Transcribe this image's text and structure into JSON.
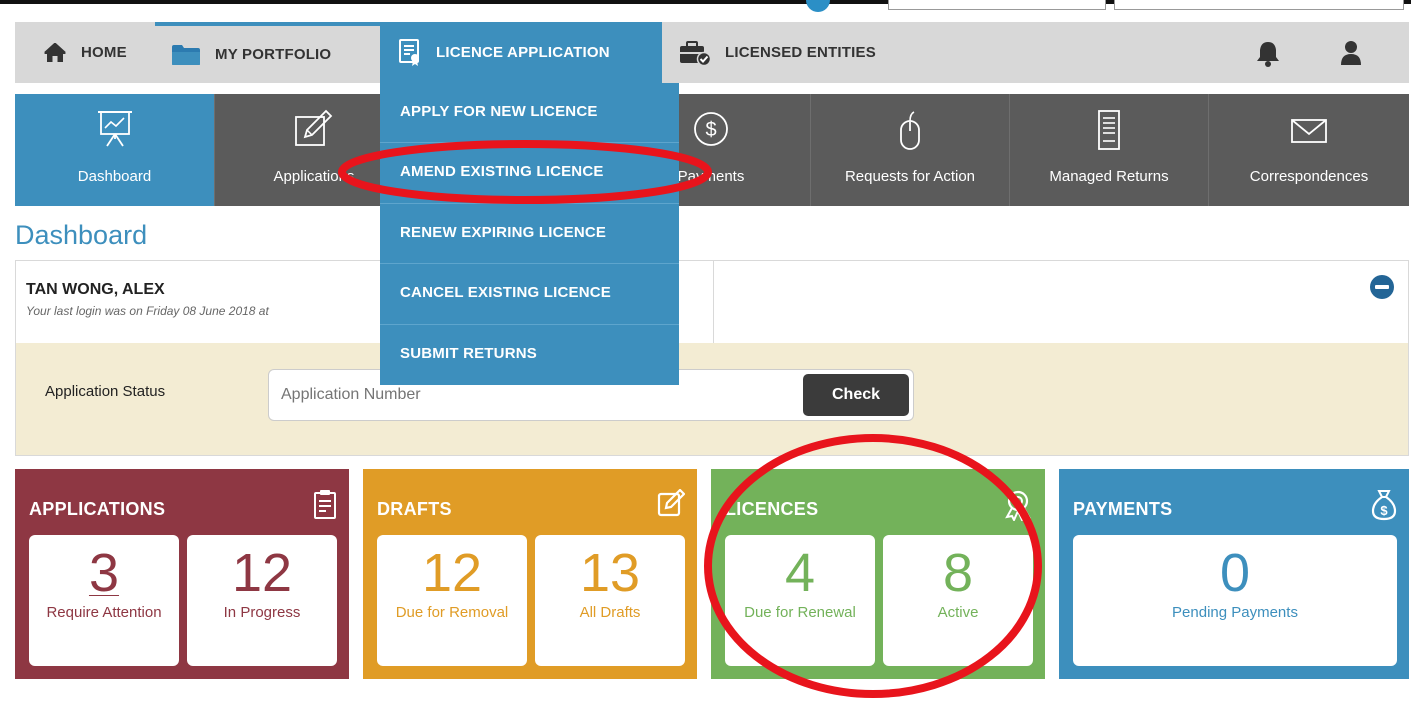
{
  "nav": {
    "home": "HOME",
    "portfolio": "MY PORTFOLIO",
    "licence_application": "LICENCE APPLICATION",
    "licensed_entities": "LICENSED ENTITIES"
  },
  "dropdown": {
    "items": [
      "APPLY FOR NEW LICENCE",
      "AMEND EXISTING LICENCE",
      "RENEW EXPIRING LICENCE",
      "CANCEL EXISTING LICENCE",
      "SUBMIT RETURNS"
    ]
  },
  "tiles": {
    "dashboard": "Dashboard",
    "applications": "Applications",
    "payments": "Payments",
    "requests": "Requests for Action",
    "returns": "Managed Returns",
    "correspondences": "Correspondences"
  },
  "dashboard": {
    "title": "Dashboard",
    "user_name": "TAN WONG, ALEX",
    "last_login": "Your last login was on Friday 08 June 2018 at",
    "status_label": "Application Status",
    "input_placeholder": "Application Number",
    "check_button": "Check"
  },
  "cards": {
    "applications": {
      "title": "APPLICATIONS",
      "stats": [
        {
          "value": "3",
          "label": "Require Attention"
        },
        {
          "value": "12",
          "label": "In Progress"
        }
      ]
    },
    "drafts": {
      "title": "DRAFTS",
      "stats": [
        {
          "value": "12",
          "label": "Due for Removal"
        },
        {
          "value": "13",
          "label": "All Drafts"
        }
      ]
    },
    "licences": {
      "title": "LICENCES",
      "stats": [
        {
          "value": "4",
          "label": "Due for Renewal"
        },
        {
          "value": "8",
          "label": "Active"
        }
      ]
    },
    "payments": {
      "title": "PAYMENTS",
      "stats": [
        {
          "value": "0",
          "label": "Pending Payments"
        }
      ]
    }
  },
  "colors": {
    "primary_blue": "#3d8fbd",
    "dark_tile": "#5b5b5b",
    "applications": "#8e3743",
    "drafts": "#e09c26",
    "licences": "#73b25a",
    "annotation_red": "#e8141c"
  }
}
